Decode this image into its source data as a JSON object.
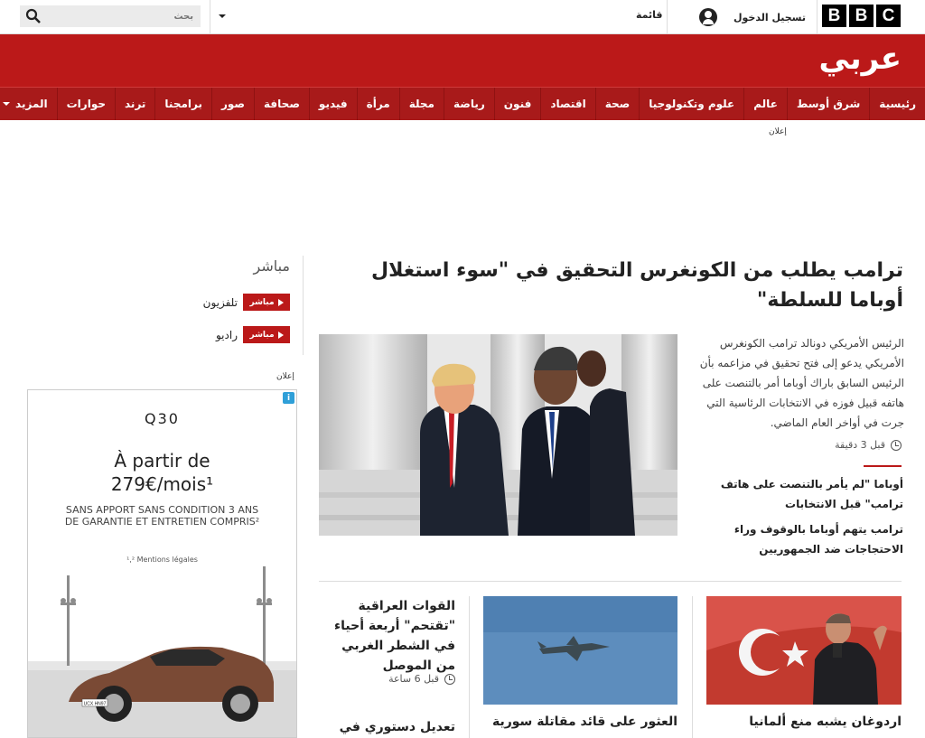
{
  "header": {
    "logo_letters": [
      "B",
      "B",
      "C"
    ],
    "signin_label": "تسجيل الدخول",
    "menu_label": "قائمة",
    "search": {
      "placeholder": "بحث",
      "value": ""
    }
  },
  "brand": {
    "title": "عربي",
    "color": "#bb1919",
    "nav_color": "#a81a1a"
  },
  "nav": {
    "items": [
      "رئيسية",
      "شرق أوسط",
      "عالم",
      "علوم وتكنولوجيا",
      "صحة",
      "اقتصاد",
      "فنون",
      "رياضة",
      "مجلة",
      "مرأة",
      "فيديو",
      "صحافة",
      "صور",
      "برامجنا",
      "ترند",
      "حوارات"
    ],
    "more_label": "المزيد"
  },
  "ad_label": "إعلان",
  "main_story": {
    "headline": "ترامب يطلب من الكونغرس التحقيق في \"سوء استغلال أوباما للسلطة\"",
    "summary": "الرئيس الأمريكي دونالد ترامب الكونغرس الأمريكي يدعو إلى فتح تحقيق في مزاعمه بأن الرئيس السابق باراك أوباما أمر بالتنصت على هاتفه قبيل فوزه في الانتخابات الرئاسية التي جرت في أواخر العام الماضي.",
    "time": "قبل 3 دقيقة",
    "related": [
      "أوباما \"لم يأمر بالتنصت على هاتف ترامب\" قبل الانتخابات",
      "ترامب يتهم أوباما بالوقوف وراء الاحتجاجات ضد الجمهوريين"
    ]
  },
  "live": {
    "title": "مباشر",
    "badge": "مباشر",
    "items": [
      "تلفزيون",
      "راديو"
    ]
  },
  "ad": {
    "model": "Q30",
    "price_line1": "À partir de",
    "price_line2": "279€/mois¹",
    "terms": "SANS APPORT SANS CONDITION 3 ANS DE GARANTIE ET ENTRETIEN COMPRIS²",
    "legal": "¹,² Mentions légales",
    "info_icon": "i",
    "plate": "UCX HN97"
  },
  "cards": [
    {
      "title": "اردوغان يشبه منع ألمانيا"
    },
    {
      "title": "العثور على قائد مقاتلة سورية"
    },
    {
      "title": "القوات العراقية \"تقتحم\" أربعة أحياء في الشطر الغربي من الموصل",
      "time": "قبل 6 ساعة"
    }
  ],
  "card3_next_title": "تعديل دستوري في"
}
